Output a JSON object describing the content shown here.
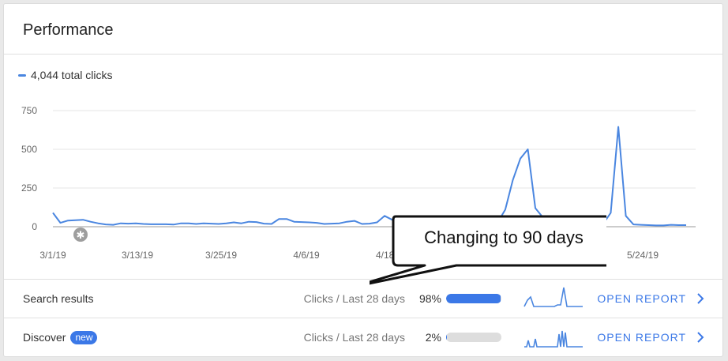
{
  "card": {
    "title": "Performance",
    "legend": {
      "label": "4,044 total clicks",
      "color": "#4a86e0"
    }
  },
  "chart_data": {
    "type": "line",
    "legend": "4,044 total clicks",
    "y_ticks": [
      "750",
      "500",
      "250",
      "0"
    ],
    "ylim": [
      0,
      750
    ],
    "x_tick_labels": [
      "3/1/19",
      "3/13/19",
      "3/25/19",
      "4/6/19",
      "4/18/19",
      "5/24/19"
    ],
    "grid": true,
    "series": [
      {
        "values": [
          90,
          25,
          40,
          42,
          45,
          32,
          22,
          15,
          12,
          22,
          20,
          22,
          18,
          16,
          16,
          16,
          14,
          22,
          22,
          18,
          22,
          20,
          18,
          22,
          28,
          22,
          32,
          30,
          20,
          18,
          50,
          50,
          32,
          30,
          28,
          25,
          18,
          20,
          22,
          32,
          38,
          18,
          20,
          28,
          70,
          45,
          35,
          38,
          28,
          20,
          18,
          20,
          18,
          22,
          20,
          25,
          20,
          18,
          22,
          28,
          110,
          300,
          440,
          500,
          120,
          60,
          20,
          18,
          15,
          20,
          18,
          12,
          15,
          20,
          90,
          645,
          70,
          15,
          12,
          10,
          8,
          8,
          12,
          10,
          10
        ]
      }
    ]
  },
  "annotation": {
    "text": "Changing to 90 days"
  },
  "rows": [
    {
      "label": "Search results",
      "badge": "",
      "metric": "Clicks / Last 28 days",
      "percent": "98%",
      "fraction": 0.98,
      "action": "OPEN REPORT"
    },
    {
      "label": "Discover",
      "badge": "new",
      "metric": "Clicks / Last 28 days",
      "percent": "2%",
      "fraction": 0.02,
      "action": "OPEN REPORT"
    }
  ],
  "colors": {
    "accent": "#3b78e7",
    "line": "#4a86e0"
  },
  "icons": {
    "chart_marker": "annotation-marker-icon",
    "row_action": "chevron-right-icon"
  }
}
